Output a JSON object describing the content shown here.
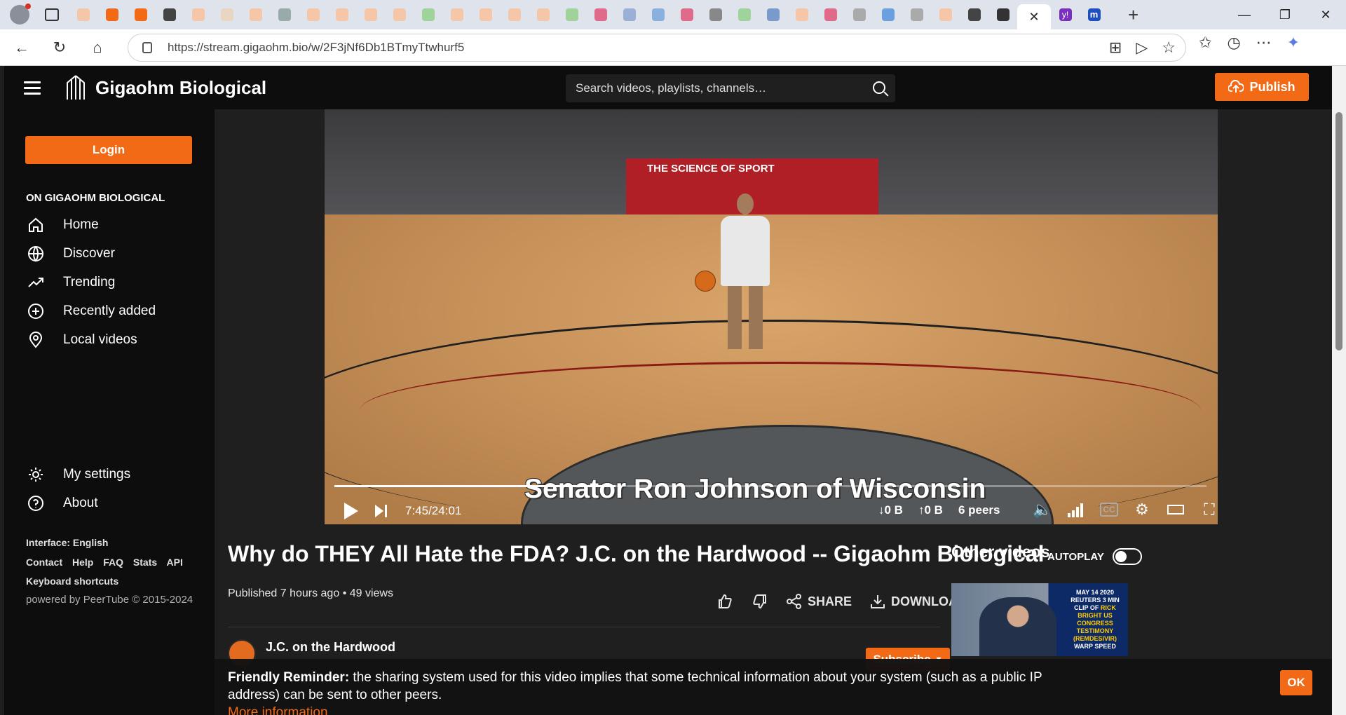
{
  "browser": {
    "url": "https://stream.gigaohm.bio/w/2F3jNf6Db1BTmyTtwhurf5",
    "tab_colors": [
      "#f5c6a8",
      "#f26a16",
      "#f26a16",
      "#444",
      "#f5c6a8",
      "#e8d6c2",
      "#f5c6a8",
      "#9aa",
      "#f5c6a8",
      "#f5c6a8",
      "#f5c6a8",
      "#f5c6a8",
      "#9fd39a",
      "#f5c6a8",
      "#f5c6a8",
      "#f5c6a8",
      "#f5c6a8",
      "#9fd39a",
      "#e06a8a",
      "#9ab0d6",
      "#8ab0e0",
      "#e06a8a",
      "#888",
      "#9fd39a",
      "#7a9acc",
      "#f5c6a8",
      "#e06a8a",
      "#aaa",
      "#6aa0e0",
      "#aaa",
      "#f5c6a8",
      "#444",
      "#333"
    ],
    "active_tab_close": "✕",
    "yahoo_icon": "y!",
    "m_icon": "m"
  },
  "site": {
    "brand": "Gigaohm Biological",
    "search_placeholder": "Search videos, playlists, channels…",
    "publish_label": "Publish",
    "accent_color": "#f26a16"
  },
  "sidebar": {
    "login_label": "Login",
    "heading": "ON GIGAOHM BIOLOGICAL",
    "items": [
      {
        "label": "Home",
        "icon": "home-icon"
      },
      {
        "label": "Discover",
        "icon": "globe-icon"
      },
      {
        "label": "Trending",
        "icon": "trending-icon"
      },
      {
        "label": "Recently added",
        "icon": "plus-circle-icon"
      },
      {
        "label": "Local videos",
        "icon": "location-icon"
      }
    ],
    "bottom_items": [
      {
        "label": "My settings",
        "icon": "gear-icon"
      },
      {
        "label": "About",
        "icon": "help-icon"
      }
    ],
    "interface_lang": "Interface: English",
    "footer_links": [
      "Contact",
      "Help",
      "FAQ",
      "Stats",
      "API"
    ],
    "keyboard_shortcuts": "Keyboard shortcuts",
    "powered_by": "powered by PeerTube © 2015-2024"
  },
  "player": {
    "caption": "Senator Ron Johnson of Wisconsin",
    "time": "7:45/24:01",
    "progress_fraction": 0.3226,
    "down": "↓0 B",
    "up": "↑0 B",
    "peers": "6 peers",
    "court_text": "THE SCIENCE OF SPORT"
  },
  "video": {
    "title": "Why do THEY All Hate the FDA? J.C. on the Hardwood -- Gigaohm Biological",
    "published": "Published 7 hours ago",
    "views": "49 views",
    "share_label": "SHARE",
    "download_label": "DOWNLOAD",
    "channel_name": "J.C. on the Hardwood",
    "subscribe_label": "Subscribe"
  },
  "other_videos": {
    "heading": "Other videos",
    "autoplay_label": "AUTOPLAY",
    "autoplay_on": false,
    "thumb_text_top": "MAY 14 2020 REUTERS 3 MIN CLIP OF",
    "thumb_text_highlight": "RICK BRIGHT US CONGRESS TESTIMONY (REMDESIVIR)",
    "thumb_text_bottom": "WARP SPEED"
  },
  "reminder": {
    "bold": "Friendly Reminder:",
    "text": " the sharing system used for this video implies that some technical information about your system (such as a public IP address) can be sent to other peers.",
    "more": "More information",
    "ok_label": "OK"
  }
}
